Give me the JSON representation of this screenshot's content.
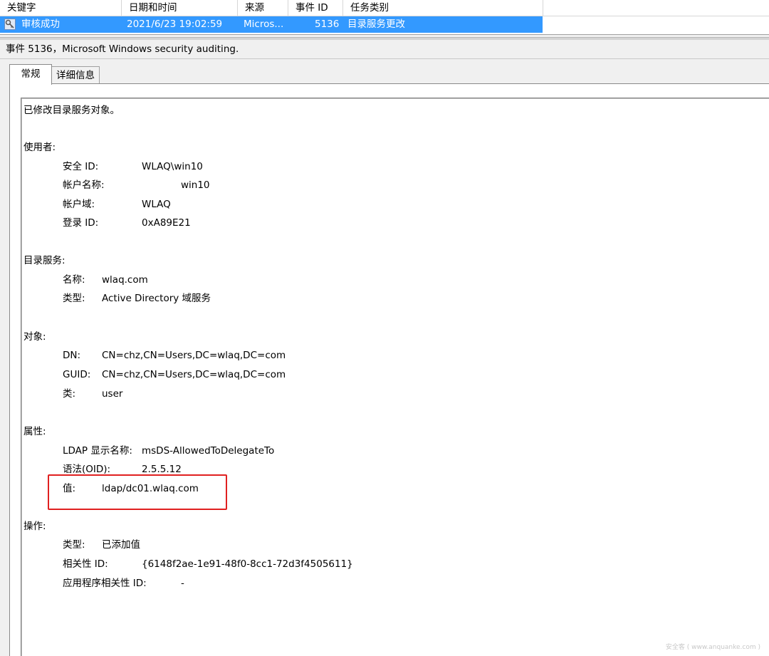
{
  "grid": {
    "headers": [
      "关键字",
      "日期和时间",
      "来源",
      "事件 ID",
      "任务类别"
    ],
    "row": {
      "keyword": "审核成功",
      "datetime": "2021/6/23 19:02:59",
      "source": "Micros...",
      "event_id": "5136",
      "task": "目录服务更改",
      "icon": "key-icon"
    }
  },
  "event_title": "事件 5136，Microsoft Windows security auditing.",
  "tabs": [
    "常规",
    "详细信息"
  ],
  "message": {
    "intro": "已修改目录服务对象。",
    "subject": {
      "heading": "使用者:",
      "security_id_label": "安全 ID:",
      "security_id": "WLAQ\\win10",
      "account_name_label": "帐户名称:",
      "account_name": "win10",
      "account_domain_label": "帐户域:",
      "account_domain": "WLAQ",
      "logon_id_label": "登录 ID:",
      "logon_id": "0xA89E21"
    },
    "directory_service": {
      "heading": "目录服务:",
      "name_label": "名称:",
      "name": "wlaq.com",
      "type_label": "类型:",
      "type": "Active Directory 域服务"
    },
    "object": {
      "heading": "对象:",
      "dn_label": "DN:",
      "dn": "CN=chz,CN=Users,DC=wlaq,DC=com",
      "guid_label": "GUID:",
      "guid": "CN=chz,CN=Users,DC=wlaq,DC=com",
      "class_label": "类:",
      "class": "user"
    },
    "attribute": {
      "heading": "属性:",
      "ldap_label": "LDAP 显示名称:",
      "ldap": "msDS-AllowedToDelegateTo",
      "syntax_label": "语法(OID):",
      "syntax": "2.5.5.12",
      "value_label": "值:",
      "value": "ldap/dc01.wlaq.com"
    },
    "operation": {
      "heading": "操作:",
      "type_label": "类型:",
      "type": "已添加值",
      "correlation_label": "相关性 ID:",
      "correlation": "{6148f2ae-1e91-48f0-8cc1-72d3f4505611}",
      "app_correlation_label": "应用程序相关性 ID:",
      "app_correlation": "-"
    }
  },
  "colors": {
    "selection": "#3399ff",
    "highlight_box": "#e02020"
  },
  "watermark": "安全客 ( www.anquanke.com )"
}
